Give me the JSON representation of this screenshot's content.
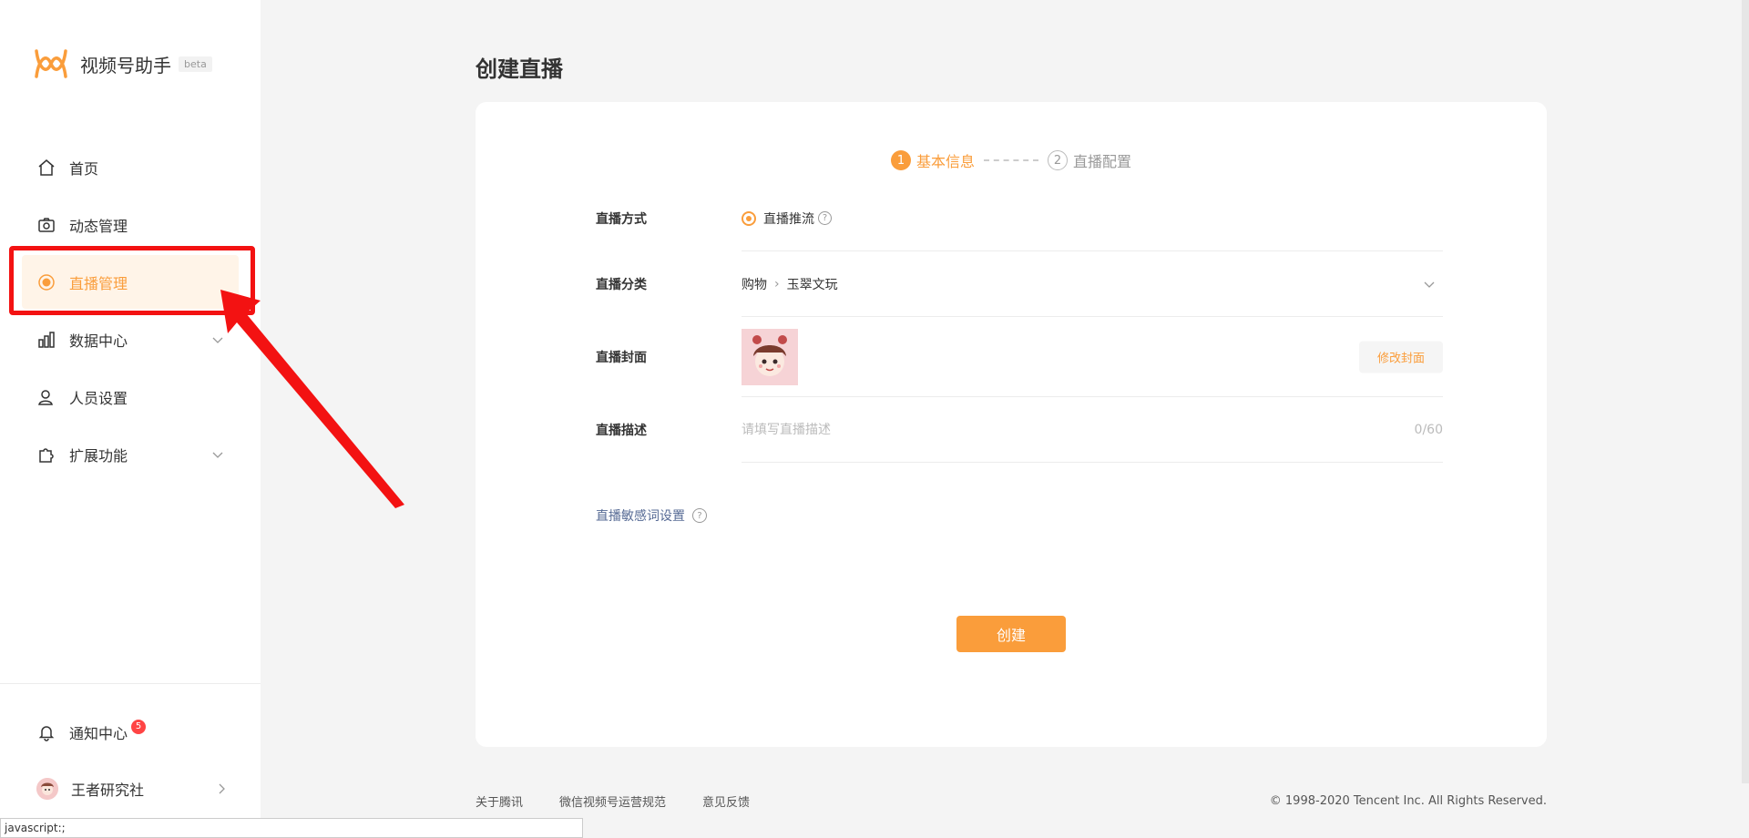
{
  "app": {
    "name": "视频号助手",
    "badge": "beta",
    "accent": "#fa9d3b"
  },
  "sidebar": {
    "items": [
      {
        "label": "首页",
        "icon": "home-icon"
      },
      {
        "label": "动态管理",
        "icon": "camera-icon"
      },
      {
        "label": "直播管理",
        "icon": "live-icon",
        "active": true
      },
      {
        "label": "数据中心",
        "icon": "chart-icon",
        "expandable": true
      },
      {
        "label": "人员设置",
        "icon": "user-settings-icon"
      },
      {
        "label": "扩展功能",
        "icon": "puzzle-icon",
        "expandable": true
      }
    ],
    "notifications": {
      "label": "通知中心",
      "count": "5"
    },
    "user": {
      "name": "王者研究社"
    }
  },
  "page": {
    "title": "创建直播"
  },
  "steps": [
    {
      "num": "1",
      "label": "基本信息",
      "active": true
    },
    {
      "num": "2",
      "label": "直播配置",
      "active": false
    }
  ],
  "form": {
    "mode": {
      "label": "直播方式",
      "value": "直播推流"
    },
    "category": {
      "label": "直播分类",
      "level1": "购物",
      "level2": "玉翠文玩"
    },
    "cover": {
      "label": "直播封面",
      "button": "修改封面"
    },
    "description": {
      "label": "直播描述",
      "placeholder": "请填写直播描述",
      "counter": "0/60"
    },
    "sensitive_link": "直播敏感词设置",
    "submit": "创建"
  },
  "footer": {
    "links": [
      "关于腾讯",
      "微信视频号运营规范",
      "意见反馈"
    ],
    "copyright": "© 1998-2020 Tencent Inc. All Rights Reserved."
  },
  "status_bar": "javascript:;"
}
